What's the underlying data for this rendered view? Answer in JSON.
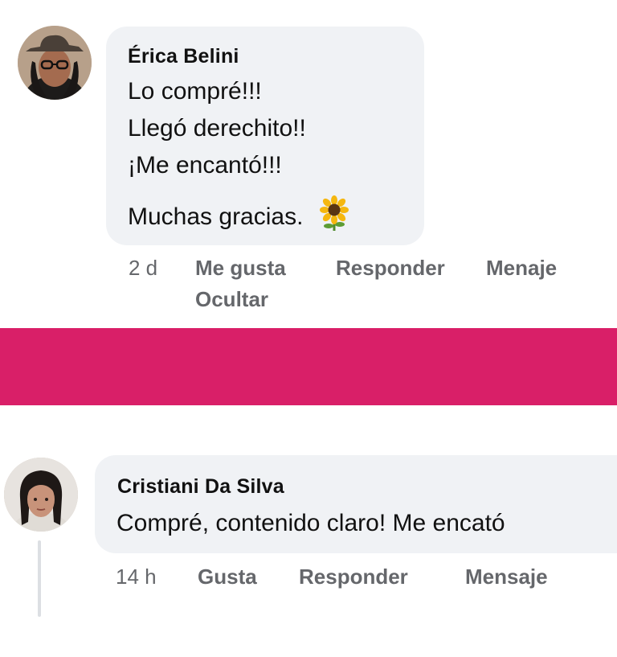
{
  "comments": [
    {
      "author": "Érica Belini",
      "lines": [
        "Lo compré!!!",
        "Llegó derechito!!",
        "¡Me encantó!!!",
        "Muchas gracias."
      ],
      "emoji_icon": "sunflower-icon",
      "time": "2 d",
      "actions": {
        "like": "Me gusta",
        "reply": "Responder",
        "message": "Menaje",
        "hide": "Ocultar"
      }
    },
    {
      "author": "Cristiani Da Silva",
      "text": "Compré, contenido claro! Me encató",
      "time": "14 h",
      "actions": {
        "like": "Gusta",
        "reply": "Responder",
        "message": "Mensaje"
      }
    }
  ],
  "colors": {
    "band": "#d91f68",
    "bubble": "#f0f2f5",
    "meta": "#65676b"
  }
}
